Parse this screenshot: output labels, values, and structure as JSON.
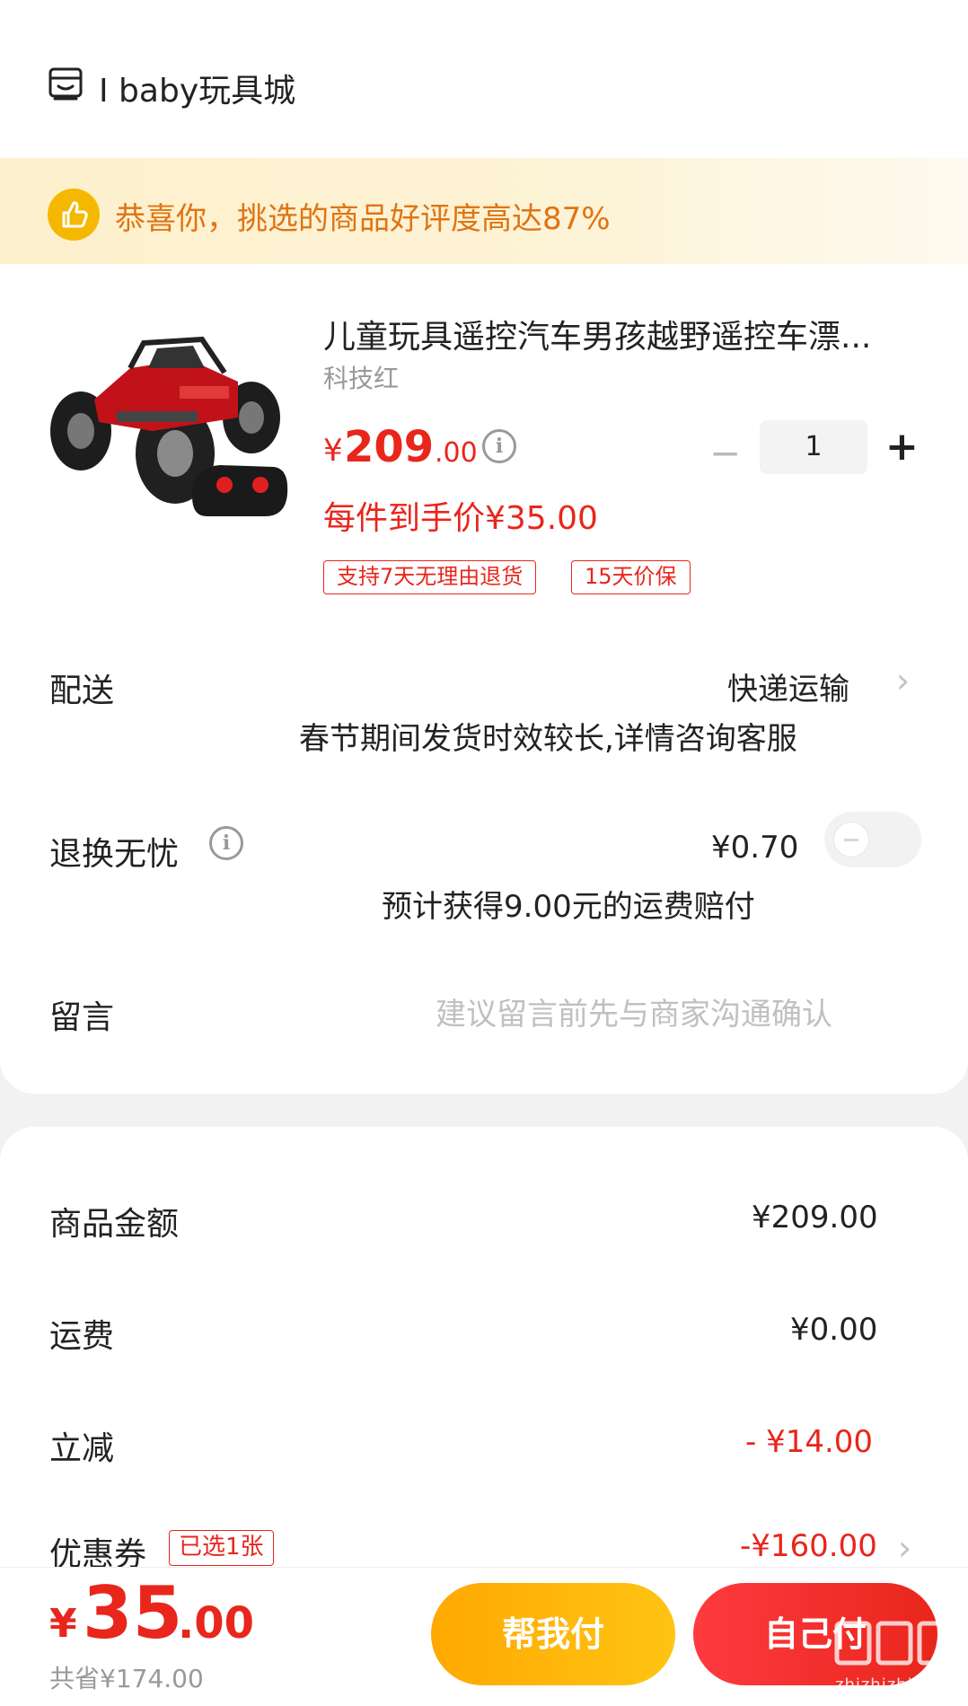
{
  "shop": {
    "name": "I baby玩具城",
    "icon": "shop-icon"
  },
  "banner": {
    "text": "恭喜你，挑选的商品好评度高达87%",
    "icon": "thumbs-up-icon"
  },
  "product": {
    "title": "儿童玩具遥控汽车男孩越野遥控车漂...",
    "variant": "科技红",
    "price_symbol": "¥",
    "price_int": "209",
    "price_dec": ".00",
    "final_price": "每件到手价¥35.00",
    "quantity": "1",
    "tags": [
      "支持7天无理由退货",
      "15天价保"
    ]
  },
  "delivery": {
    "label": "配送",
    "method": "快递运输",
    "note": "春节期间发货时效较长,详情咨询客服"
  },
  "return_insurance": {
    "label": "退换无忧",
    "price": "¥0.70",
    "note": "预计获得9.00元的运费赔付",
    "enabled": false
  },
  "message": {
    "label": "留言",
    "placeholder": "建议留言前先与商家沟通确认"
  },
  "summary": {
    "goods_label": "商品金额",
    "goods_value": "¥209.00",
    "shipping_label": "运费",
    "shipping_value": "¥0.00",
    "discount_label": "立减",
    "discount_value": "- ¥14.00",
    "coupon_label": "优惠券",
    "coupon_badge": "已选1张",
    "coupon_value": "-¥160.00"
  },
  "footer": {
    "total_symbol": "¥",
    "total_int": "35",
    "total_dec": ".00",
    "saved": "共省¥174.00",
    "help_pay": "帮我付",
    "self_pay": "自己付"
  },
  "watermark": {
    "text": "zhizhizhi.com"
  },
  "colors": {
    "accent": "#e8261c",
    "banner_text": "#e07414",
    "help_btn": "#ffb400"
  }
}
